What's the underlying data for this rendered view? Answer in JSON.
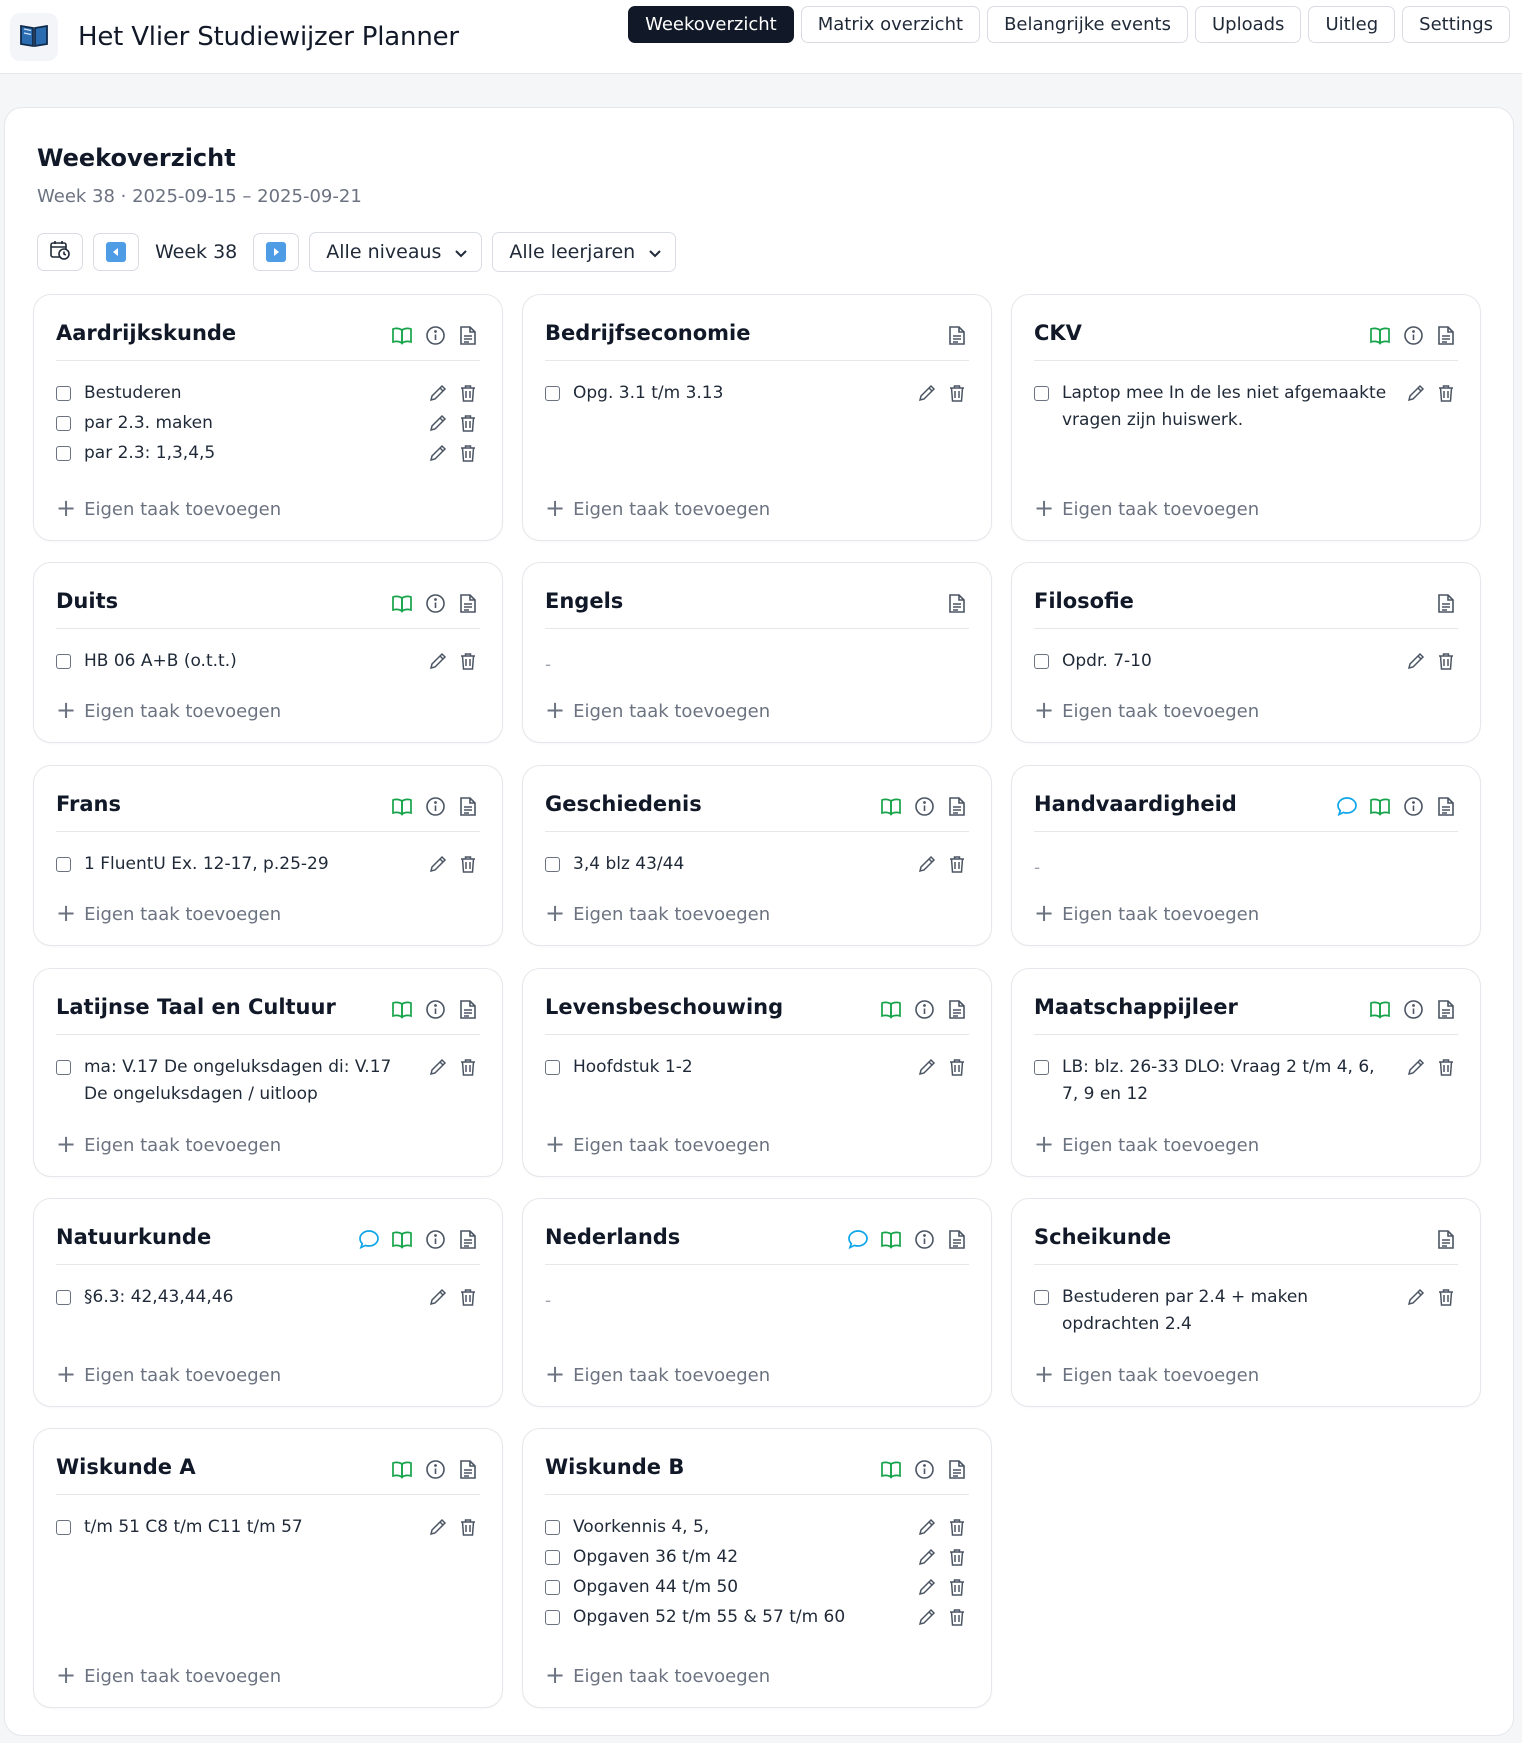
{
  "app": {
    "title": "Het Vlier Studiewijzer Planner",
    "nav": [
      "Weekoverzicht",
      "Matrix overzicht",
      "Belangrijke events",
      "Uploads",
      "Uitleg",
      "Settings"
    ],
    "active_nav": "Weekoverzicht"
  },
  "main": {
    "title": "Weekoverzicht",
    "subtitle": "Week 38 · 2025-09-15 – 2025-09-21",
    "week_label": "Week 38",
    "level_filter": "Alle niveaus",
    "year_filter": "Alle leerjaren",
    "add_task_label": "Eigen taak toevoegen",
    "empty_placeholder": "-"
  },
  "colors": {
    "green_icon": "#16a34a",
    "teal_chat": "#0ea5e9",
    "gray_icon": "#6b7280",
    "active_bg": "#111827"
  },
  "subjects": [
    {
      "name": "Aardrijkskunde",
      "icons": [
        "book",
        "info",
        "doc"
      ],
      "tasks": [
        "Bestuderen",
        "par 2.3. maken",
        "par 2.3: 1,3,4,5"
      ]
    },
    {
      "name": "Bedrijfseconomie",
      "icons": [
        "doc"
      ],
      "tasks": [
        "Opg. 3.1 t/m 3.13"
      ]
    },
    {
      "name": "CKV",
      "icons": [
        "book",
        "info",
        "doc"
      ],
      "tasks": [
        "Laptop mee In de les niet afgemaakte vragen zijn huiswerk."
      ]
    },
    {
      "name": "Duits",
      "icons": [
        "book",
        "info",
        "doc"
      ],
      "tasks": [
        "HB 06 A+B (o.t.t.)"
      ]
    },
    {
      "name": "Engels",
      "icons": [
        "doc"
      ],
      "tasks": []
    },
    {
      "name": "Filosofie",
      "icons": [
        "doc"
      ],
      "tasks": [
        "Opdr. 7-10"
      ]
    },
    {
      "name": "Frans",
      "icons": [
        "book",
        "info",
        "doc"
      ],
      "tasks": [
        "1 FluentU Ex. 12-17, p.25-29"
      ]
    },
    {
      "name": "Geschiedenis",
      "icons": [
        "book",
        "info",
        "doc"
      ],
      "tasks": [
        "3,4 blz 43/44"
      ]
    },
    {
      "name": "Handvaardigheid",
      "icons": [
        "chat",
        "book",
        "info",
        "doc"
      ],
      "tasks": []
    },
    {
      "name": "Latijnse Taal en Cultuur",
      "icons": [
        "book",
        "info",
        "doc"
      ],
      "tasks": [
        "ma: V.17 De ongeluksdagen di: V.17 De ongeluksdagen / uitloop"
      ]
    },
    {
      "name": "Levensbeschouwing",
      "icons": [
        "book",
        "info",
        "doc"
      ],
      "tasks": [
        "Hoofdstuk 1-2"
      ]
    },
    {
      "name": "Maatschappijleer",
      "icons": [
        "book",
        "info",
        "doc"
      ],
      "tasks": [
        "LB: blz. 26-33 DLO: Vraag 2 t/m 4, 6, 7, 9 en 12"
      ]
    },
    {
      "name": "Natuurkunde",
      "icons": [
        "chat",
        "book",
        "info",
        "doc"
      ],
      "tasks": [
        "§6.3: 42,43,44,46"
      ]
    },
    {
      "name": "Nederlands",
      "icons": [
        "chat",
        "book",
        "info",
        "doc"
      ],
      "tasks": []
    },
    {
      "name": "Scheikunde",
      "icons": [
        "doc"
      ],
      "tasks": [
        "Bestuderen par 2.4 + maken opdrachten 2.4"
      ]
    },
    {
      "name": "Wiskunde A",
      "icons": [
        "book",
        "info",
        "doc"
      ],
      "tasks": [
        "t/m 51 C8 t/m C11 t/m 57"
      ]
    },
    {
      "name": "Wiskunde B",
      "icons": [
        "book",
        "info",
        "doc"
      ],
      "tasks": [
        "Voorkennis 4, 5,",
        "Opgaven 36 t/m 42",
        "Opgaven 44 t/m 50",
        "Opgaven 52 t/m 55 & 57 t/m 60"
      ]
    }
  ]
}
